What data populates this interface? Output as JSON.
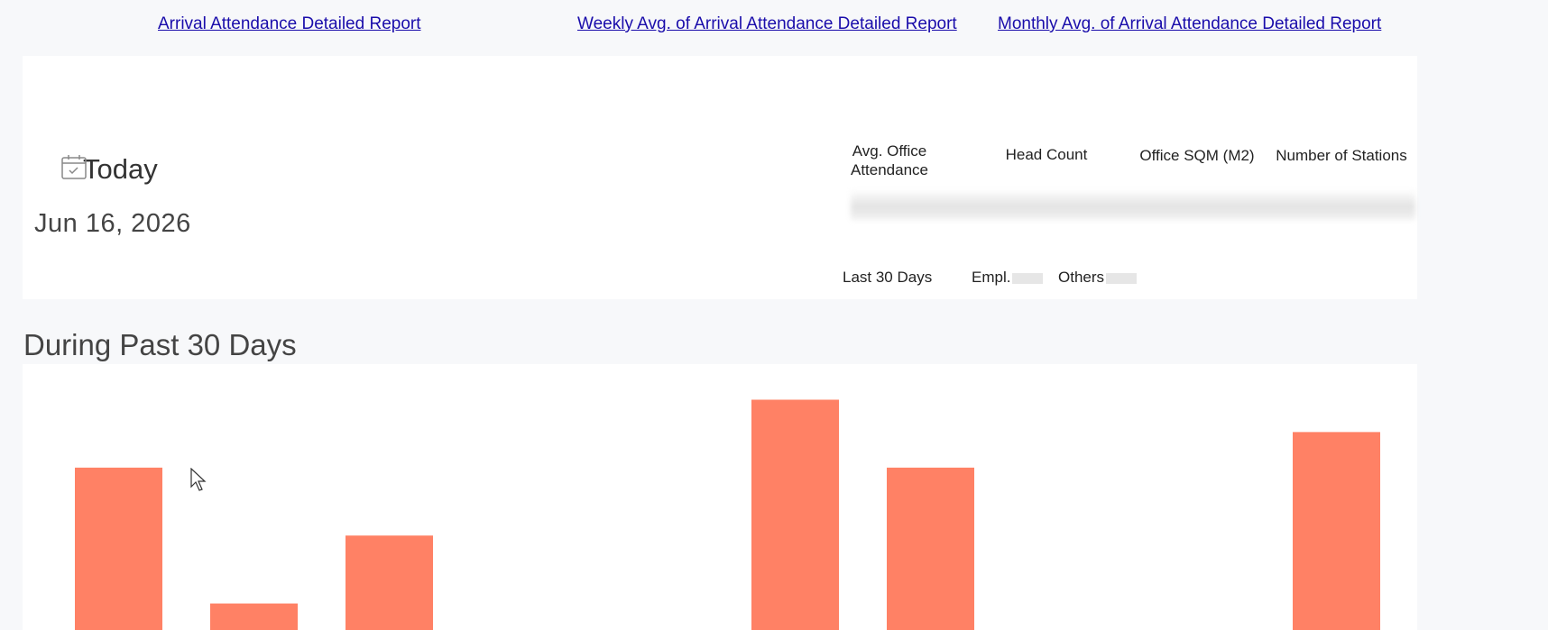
{
  "links": [
    {
      "label": "Arrival Attendance Detailed Report"
    },
    {
      "label": "Weekly Avg. of Arrival Attendance Detailed Report"
    },
    {
      "label": "Monthly Avg. of Arrival Attendance Detailed Report"
    }
  ],
  "summary": {
    "today_label": "Today",
    "date": "Jun 16, 2026",
    "metrics": [
      {
        "label": "Avg. Office Attendance"
      },
      {
        "label": "Head Count"
      },
      {
        "label": "Office SQM (M2)"
      },
      {
        "label": "Number of Stations"
      }
    ],
    "legend": {
      "period": "Last 30 Days",
      "employees": "Empl.",
      "others": "Others"
    }
  },
  "section_title": "During Past 30 Days",
  "colors": {
    "bar": "#ff8165",
    "link": "#1a0dab",
    "background": "#f7f8fa",
    "card": "#ffffff"
  },
  "chart_data": {
    "type": "bar",
    "values": [
      0.58,
      0.16,
      0.37,
      0.02,
      0.02,
      0.79,
      0.58,
      0.02,
      0.02,
      0.69
    ],
    "ylim": [
      0,
      0.9
    ],
    "title": "",
    "xlabel": "",
    "ylabel": ""
  }
}
